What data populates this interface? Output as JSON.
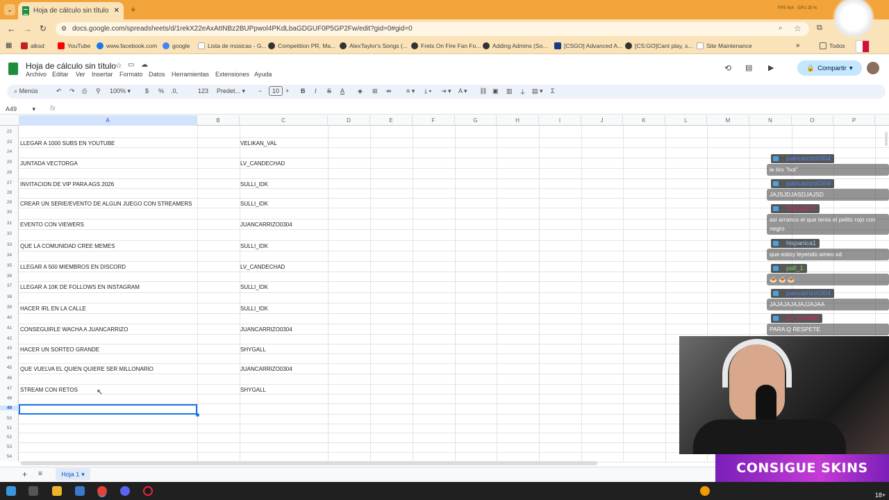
{
  "browser": {
    "tab_title": "Hoja de cálculo sin título - Hoj",
    "url": "docs.google.com/spreadsheets/d/1rekX22eAxAtINBz2BUPpwol4PKdLbaGDGUF0P5GP2Fw/edit?gid=0#gid=0",
    "bookmarks": [
      "alksd",
      "YouTube",
      "www.facebook.com",
      "google",
      "Lista de músicas - G...",
      "Competition PR, Ma...",
      "AlexTaylor's Songs (...",
      "Frets On Fire Fan Fo...",
      "Adding Admins (So...",
      "[CSGO] Advanced A...",
      "[CS:GO]Cant play, s...",
      "Site Maintenance"
    ],
    "bookmarks_folder": "Todos"
  },
  "sheets": {
    "doc_title": "Hoja de cálculo sin título",
    "menus": [
      "Archivo",
      "Editar",
      "Ver",
      "Insertar",
      "Formato",
      "Datos",
      "Herramientas",
      "Extensiones",
      "Ayuda"
    ],
    "share_label": "Compartir",
    "toolbar": {
      "menus": "Menús",
      "zoom": "100%",
      "currency": "$",
      "percent": "%",
      "dec_less": ".0,",
      ".00": ".00",
      "format123": "123",
      "font": "Predet...",
      "font_size": "10"
    },
    "name_box": "A49",
    "fx": "fx",
    "columns": [
      "A",
      "B",
      "C",
      "D",
      "E",
      "F",
      "G",
      "H",
      "I",
      "J",
      "K",
      "L",
      "M",
      "N",
      "O",
      "P"
    ],
    "row_numbers": [
      "22",
      "23",
      "24",
      "25",
      "26",
      "27",
      "28",
      "29",
      "30",
      "31",
      "32",
      "33",
      "34",
      "35",
      "36",
      "37",
      "38",
      "39",
      "40",
      "41",
      "42",
      "43",
      "44",
      "45",
      "46",
      "47",
      "48",
      "49",
      "50",
      "51",
      "52",
      "53",
      "54"
    ],
    "rows": [
      {
        "a": "LLEGAR A 1000 SUBS EN YOUTUBE",
        "c": "VELIKAN_VAL"
      },
      {
        "a": "JUNTADA VECTORGA",
        "c": "LV_CANDECHAD"
      },
      {
        "a": "INVITACION DE VIP PARA AGS 2026",
        "c": "SULLI_IDK"
      },
      {
        "a": "CREAR UN SERIE/EVENTO DE ALGUN JUEGO CON STREAMERS",
        "c": "SULLI_IDK"
      },
      {
        "a": "EVENTO CON VIEWERS",
        "c": "JUANCARRIZO0304"
      },
      {
        "a": "QUE LA COMUNIDAD CREE MEMES",
        "c": "SULLI_IDK"
      },
      {
        "a": "LLEGAR A 500 MIEMBROS EN DISCORD",
        "c": "LV_CANDECHAD"
      },
      {
        "a": "LLEGAR A 10K DE FOLLOWS EN INSTAGRAM",
        "c": "SULLI_IDK"
      },
      {
        "a": "HACER IRL EN LA CALLE",
        "c": "SULLI_IDK"
      },
      {
        "a": "CONSEGUIRLE WACHA A JUANCARRIZO",
        "c": "JUANCARRIZO0304"
      },
      {
        "a": "HACER UN SORTEO GRANDE",
        "c": "SHYGALL"
      },
      {
        "a": "QUE VUELVA EL QUIEN QUIERE SER MILLONARIO",
        "c": "JUANCARRIZO0304"
      },
      {
        "a": "STREAM CON RETOS",
        "c": "SHYGALL"
      }
    ],
    "sheet_tab": "Hoja 1"
  },
  "chat": [
    {
      "user": "juancarrizo0304",
      "color": "#4a8df5",
      "msg": "le tiro \"hot\""
    },
    {
      "user": "juancarrizo0304",
      "color": "#4a8df5",
      "msg": "JAJSJDJASDJAJSD"
    },
    {
      "user": "ShyGallVT",
      "color": "#e0245e",
      "msg": "asi arranco el que tenia el pelito rojo con negro"
    },
    {
      "user": "hispanica1",
      "color": "#a0c8ff",
      "msg": "que estoy leyendo ameo xd"
    },
    {
      "user": "palt_1",
      "color": "#7cd95a",
      "msg": "🍝 🍝 🍝"
    },
    {
      "user": "juancarrizo0304",
      "color": "#4a8df5",
      "msg": "JAJAJAJAJAJJAJAA"
    },
    {
      "user": "LV_CANDE",
      "color": "#e0245e",
      "msg": "PARA Q RESPETE"
    }
  ],
  "stream": {
    "banner": "CONSIGUE SKINS",
    "age_badge": "18+"
  },
  "colors": {
    "tabstrip": "#f2a33a",
    "sheets_green": "#1e8e3e",
    "selection": "#1a73e8",
    "share": "#c2e7ff"
  }
}
